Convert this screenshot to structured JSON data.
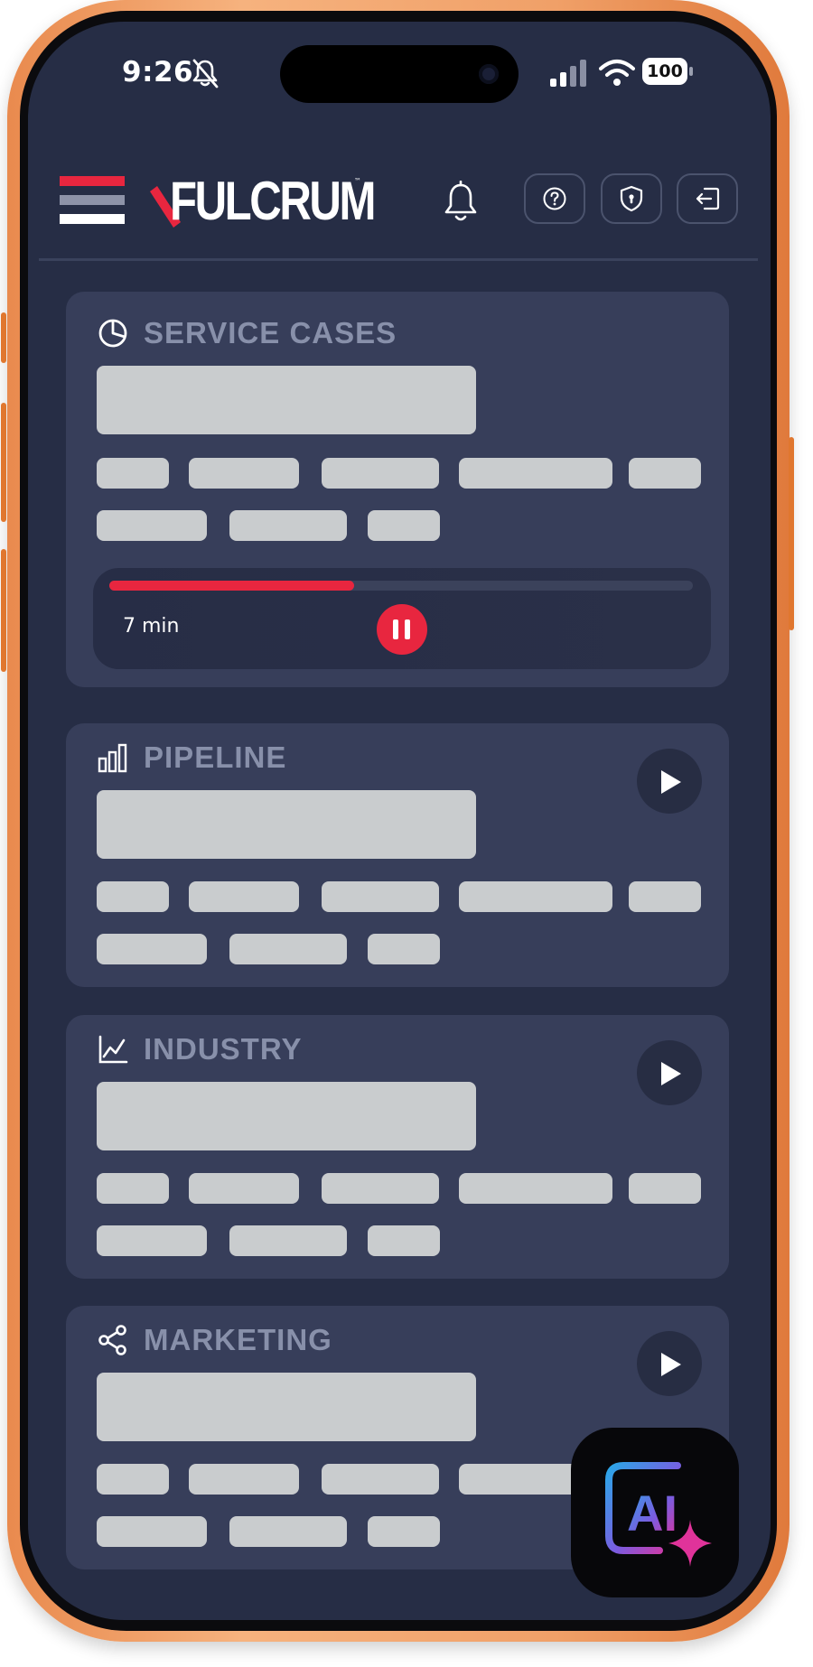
{
  "status_bar": {
    "time": "9:26",
    "battery": "100"
  },
  "header": {
    "logo_text": "FULCRUM",
    "logo_tm": "™",
    "help_icon": "question-icon",
    "privacy_icon": "shield-icon",
    "logout_icon": "logout-icon"
  },
  "colors": {
    "accent_red": "#e8263f",
    "background": "#262d45",
    "card": "#373e5a",
    "skeleton": "#c9ccce",
    "title_gray": "#8890aa"
  },
  "cards": [
    {
      "title": "SERVICE CASES",
      "icon": "pie-chart-icon",
      "playing": true
    },
    {
      "title": "PIPELINE",
      "icon": "bar-chart-icon",
      "playing": false
    },
    {
      "title": "INDUSTRY",
      "icon": "line-chart-icon",
      "playing": false
    },
    {
      "title": "MARKETING",
      "icon": "share-icon",
      "playing": false
    }
  ],
  "player": {
    "elapsed_label": "7 min",
    "progress": 0.42
  },
  "ai_button": {
    "label": "AI"
  }
}
